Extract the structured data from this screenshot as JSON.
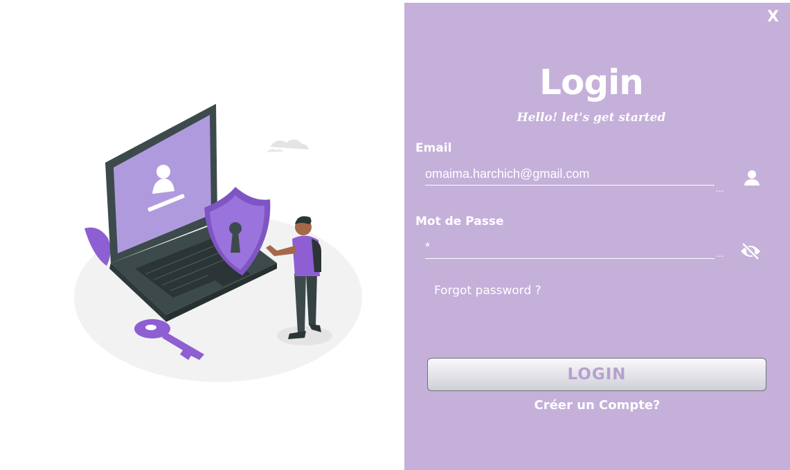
{
  "window": {
    "close_label": "X"
  },
  "login": {
    "title": "Login",
    "subtitle": "Hello!  let's get started",
    "email_label": "Email",
    "email_value": "omaima.harchich@gmail.com",
    "password_label": "Mot de Passe",
    "password_value": "*",
    "ellipsis": "...",
    "forgot_password": "Forgot password ?",
    "login_button": "LOGIN",
    "create_account": "Créer un Compte?"
  },
  "colors": {
    "panel_background": "#c5b0da",
    "accent_purple": "#8d5fd3",
    "text_white": "#ffffff",
    "button_text": "#b6a0cf"
  },
  "icons": {
    "email_icon": "user-icon",
    "password_icon": "eye-slash-icon",
    "illustration": "laptop-security-illustration"
  }
}
